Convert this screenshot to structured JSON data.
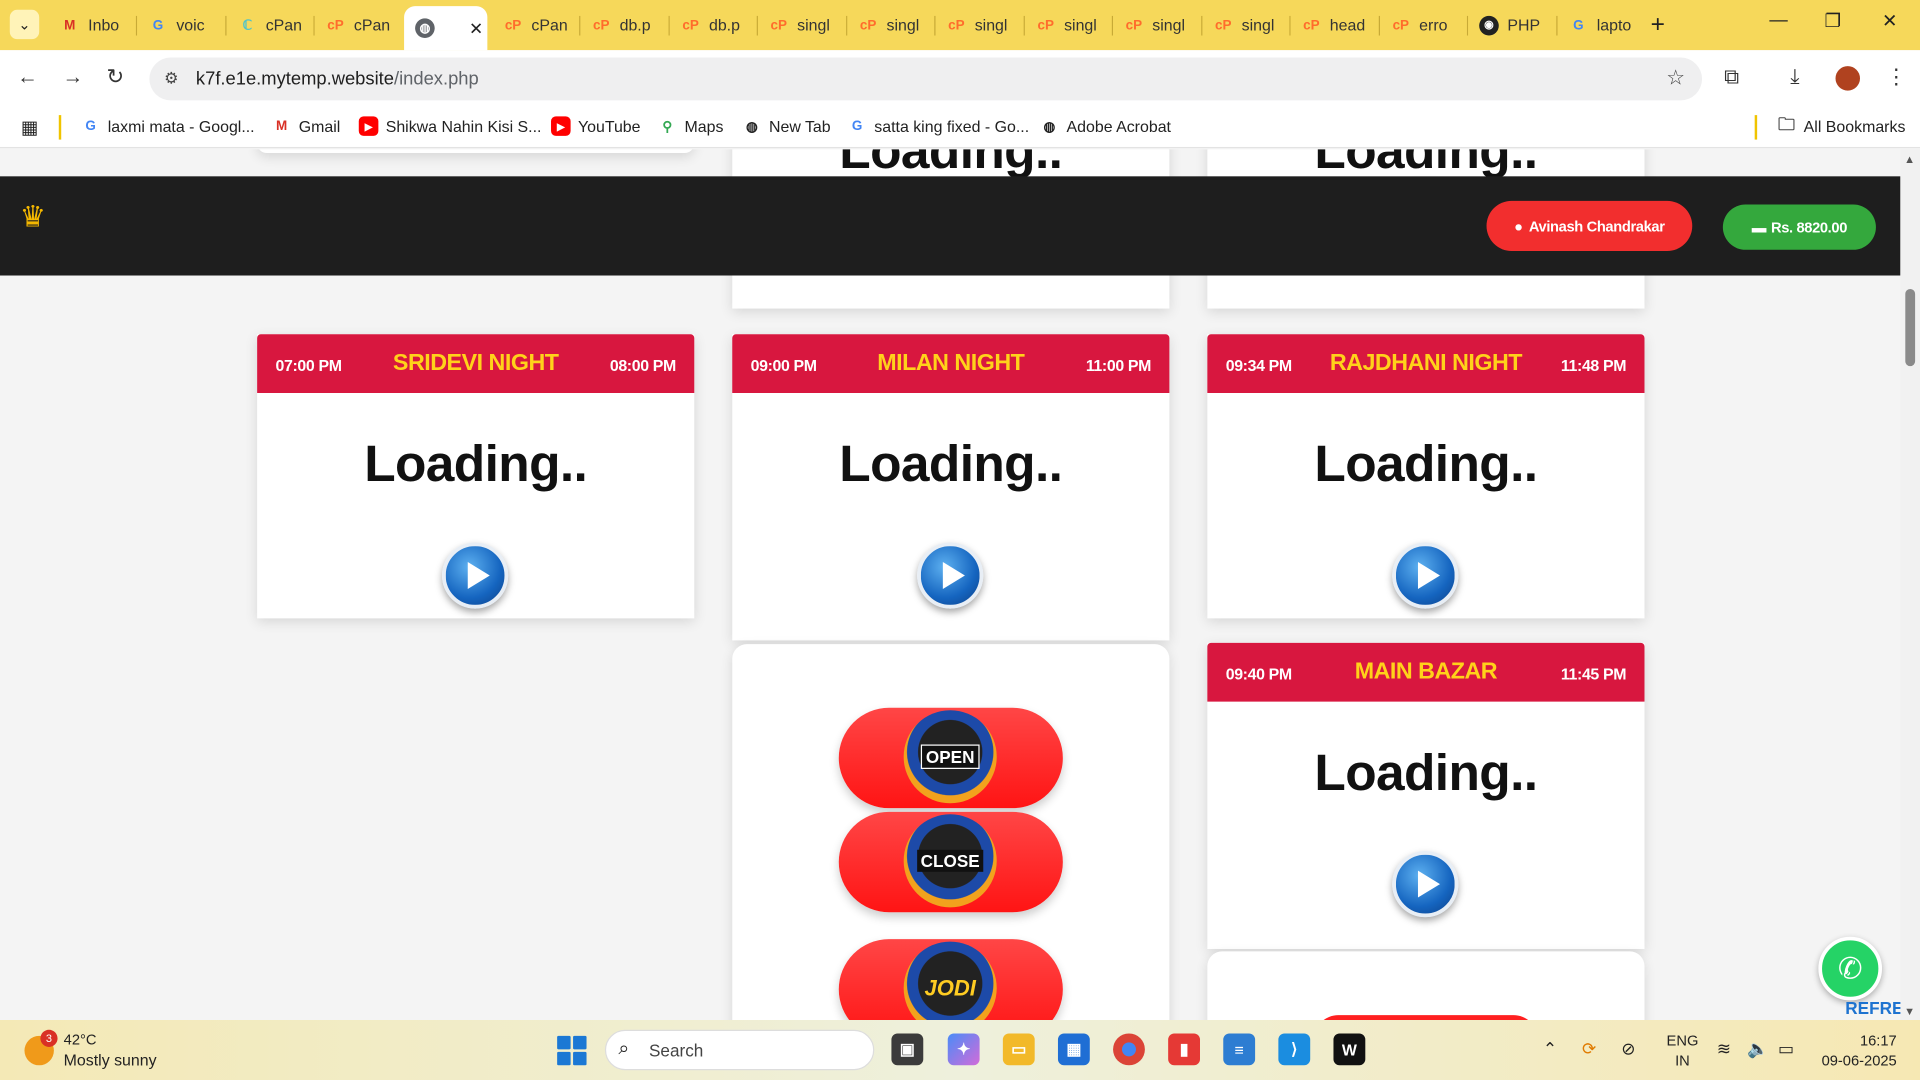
{
  "browser": {
    "tabs": [
      {
        "label": "Inbo",
        "icon": "gmail-icon"
      },
      {
        "label": "voic",
        "icon": "google-icon"
      },
      {
        "label": "cPan",
        "icon": "cpanel-icon"
      },
      {
        "label": "cPan",
        "icon": "cpanel-icon"
      },
      {
        "label": "",
        "icon": "globe-icon"
      },
      {
        "label": "cPan",
        "icon": "cpanel-icon"
      },
      {
        "label": "db.p",
        "icon": "cpanel-icon"
      },
      {
        "label": "db.p",
        "icon": "cpanel-icon"
      },
      {
        "label": "singl",
        "icon": "cpanel-icon"
      },
      {
        "label": "singl",
        "icon": "cpanel-icon"
      },
      {
        "label": "singl",
        "icon": "cpanel-icon"
      },
      {
        "label": "singl",
        "icon": "cpanel-icon"
      },
      {
        "label": "singl",
        "icon": "cpanel-icon"
      },
      {
        "label": "singl",
        "icon": "cpanel-icon"
      },
      {
        "label": "head",
        "icon": "cpanel-icon"
      },
      {
        "label": "erro",
        "icon": "cpanel-icon"
      },
      {
        "label": "PHP",
        "icon": "php-icon"
      },
      {
        "label": "lapto",
        "icon": "google-icon"
      }
    ],
    "url_host": "k7f.e1e.mytemp.website",
    "url_path": "/index.php",
    "bookmarks": [
      {
        "label": "laxmi mata - Googl...",
        "icon": "google-icon"
      },
      {
        "label": "Gmail",
        "icon": "gmail-icon"
      },
      {
        "label": "Shikwa Nahin Kisi S...",
        "icon": "youtube-icon"
      },
      {
        "label": "YouTube",
        "icon": "youtube-icon"
      },
      {
        "label": "Maps",
        "icon": "maps-icon"
      },
      {
        "label": "New Tab",
        "icon": "globe-icon"
      },
      {
        "label": "satta king fixed - Go...",
        "icon": "google-icon"
      },
      {
        "label": "Adobe Acrobat",
        "icon": "globe-icon"
      }
    ],
    "all_bookmarks": "All Bookmarks"
  },
  "header": {
    "user_name": "Avinash Chandrakar",
    "wallet": "Rs. 8820.00"
  },
  "markets": [
    {
      "name": "SRIDEVI NIGHT",
      "open": "07:00 PM",
      "close": "08:00 PM",
      "status": "Loading.."
    },
    {
      "name": "MILAN NIGHT",
      "open": "09:00 PM",
      "close": "11:00 PM",
      "status": "Loading.."
    },
    {
      "name": "RAJDHANI NIGHT",
      "open": "09:34 PM",
      "close": "11:48 PM",
      "status": "Loading.."
    },
    {
      "name": "MAIN BAZAR",
      "open": "09:40 PM",
      "close": "11:45 PM",
      "status": "Loading.."
    }
  ],
  "partial_cards": {
    "status": "Loading.."
  },
  "chart_buttons": {
    "open": "OPEN",
    "close": "CLOSE",
    "jodi": "JODI"
  },
  "floating": {
    "refresh": "REFRES"
  },
  "taskbar": {
    "weather_temp": "42°C",
    "weather_desc": "Mostly sunny",
    "weather_badge": "3",
    "search": "Search",
    "lang_1": "ENG",
    "lang_2": "IN",
    "time": "16:17",
    "date": "09-06-2025"
  },
  "colors": {
    "card_header": "#d8173f",
    "market_title": "#ffd21a",
    "user_button": "#f22e2e",
    "wallet_button": "#34a83d",
    "tab_strip": "#f6d85a"
  }
}
